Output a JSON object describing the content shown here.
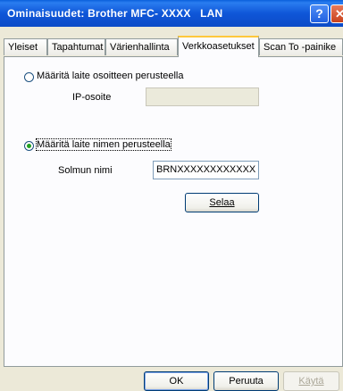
{
  "window": {
    "title": "Ominaisuudet: Brother MFC- XXXX   LAN",
    "help_label": "?",
    "close_label": "✕"
  },
  "tabs": [
    {
      "label": "Yleiset"
    },
    {
      "label": "Tapahtumat"
    },
    {
      "label": "Värienhallinta"
    },
    {
      "label": "Verkkoasetukset"
    },
    {
      "label": "Scan To -painike"
    }
  ],
  "active_tab": "Verkkoasetukset",
  "panel": {
    "radio_ip_label": "Määritä laite osoitteen perusteella",
    "radio_ip_checked": false,
    "ip_label": "IP-osoite",
    "ip_value": "",
    "radio_name_label": "Määritä laite nimen perusteella",
    "radio_name_checked": true,
    "node_label": "Solmun nimi",
    "node_value": "BRNXXXXXXXXXXXX",
    "browse_label": "Selaa"
  },
  "footer": {
    "ok_label": "OK",
    "cancel_label": "Peruuta",
    "apply_label": "Käytä"
  }
}
